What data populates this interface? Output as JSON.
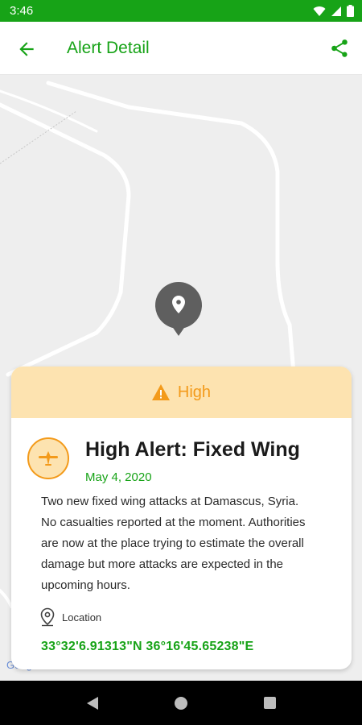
{
  "status_bar": {
    "time": "3:46"
  },
  "app_bar": {
    "title": "Alert Detail"
  },
  "map": {
    "watermark": "Goog"
  },
  "alert": {
    "severity": "High",
    "title": "High Alert: Fixed Wing",
    "date": "May 4, 2020",
    "description": "Two new fixed wing attacks at Damascus, Syria. No casualties reported at the moment. Authorities are now at the place trying to estimate the overall damage but more attacks are expected in the upcoming hours.",
    "location_label": "Location",
    "coordinates": "33°32'6.91313\"N  36°16'45.65238\"E"
  },
  "colors": {
    "primary": "#17a317",
    "warning": "#f39a1a",
    "warning_bg": "#fde3b0"
  }
}
